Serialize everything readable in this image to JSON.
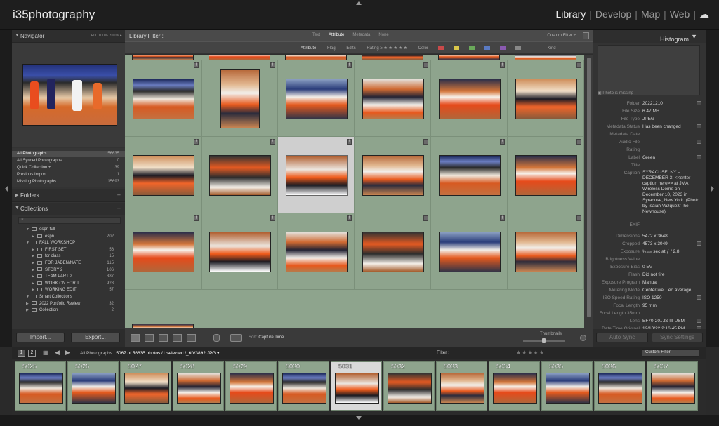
{
  "app": {
    "brand": "i35photography",
    "modules": [
      "Library",
      "Develop",
      "Map",
      "Web"
    ],
    "active_module": "Library",
    "cloud_icon": "cloud-icon"
  },
  "navigator": {
    "title": "Navigator",
    "zoom_levels": "FIT  100%  200%  ▸"
  },
  "catalog": [
    {
      "label": "All Photographs",
      "count": "56635",
      "selected": true
    },
    {
      "label": "All Synced Photographs",
      "count": "0"
    },
    {
      "label": "Quick Collection +",
      "count": "39"
    },
    {
      "label": "Previous Import",
      "count": "1"
    },
    {
      "label": "Missing Photographs",
      "count": "15693"
    }
  ],
  "folders": {
    "title": "Folders"
  },
  "collections": {
    "title": "Collections",
    "items": [
      {
        "label": "espn full",
        "count": "",
        "indent": 1
      },
      {
        "label": "espn",
        "count": "202",
        "indent": 2
      },
      {
        "label": "FALL WORKSHOP",
        "count": "",
        "indent": 1
      },
      {
        "label": "FIRST SET",
        "count": "56",
        "indent": 2
      },
      {
        "label": "for class",
        "count": "15",
        "indent": 2
      },
      {
        "label": "FOR JADEN/NATE",
        "count": "115",
        "indent": 2
      },
      {
        "label": "STORY 2",
        "count": "106",
        "indent": 2
      },
      {
        "label": "TEAM PART 2",
        "count": "387",
        "indent": 2
      },
      {
        "label": "WORK ON FOR T...",
        "count": "928",
        "indent": 2
      },
      {
        "label": "WORKING EDIT",
        "count": "57",
        "indent": 2
      },
      {
        "label": "Smart Collections",
        "count": "",
        "indent": 1
      },
      {
        "label": "2022 Portfolio Review",
        "count": "32",
        "indent": 1
      },
      {
        "label": "Collection",
        "count": "2",
        "indent": 1
      }
    ]
  },
  "left_buttons": {
    "import": "Import...",
    "export": "Export..."
  },
  "filter_bar": {
    "title": "Library Filter :",
    "tabs": [
      "Text",
      "Attribute",
      "Metadata",
      "None"
    ],
    "active_tab": "Attribute",
    "custom_filter": "Custom Filter ÷"
  },
  "attribute_bar": {
    "attribute": "Attribute",
    "flag": "Flag",
    "edits": "Edits",
    "rating": "Rating  ≥  ★ ★ ★ ★ ★",
    "color": "Color",
    "kind": "Kind",
    "swatches": [
      "#c94a4a",
      "#d9c64a",
      "#6aa85a",
      "#5a7ac2",
      "#8a5ab0",
      "#888888"
    ]
  },
  "grid": {
    "rows": [
      [
        "g3",
        "g1",
        "g5",
        "g6",
        "g2",
        "g4"
      ],
      [
        "g4",
        "g8",
        "g7",
        "g1",
        "g3",
        "g2"
      ],
      [
        "g2",
        "g7",
        "g6",
        "g8",
        "g5",
        "g1"
      ]
    ],
    "selected_index": 8
  },
  "toolbar": {
    "sort_label": "Sort:",
    "sort_value": "Capture Time",
    "thumbnails": "Thumbnails"
  },
  "histogram": {
    "title": "Histogram",
    "missing": "Photo is missing"
  },
  "metadata": [
    {
      "k": "Folder",
      "v": "20221210",
      "btn": true
    },
    {
      "k": "File Size",
      "v": "6.47 MB"
    },
    {
      "k": "File Type",
      "v": "JPEG"
    },
    {
      "k": "Metadata Status",
      "v": "Has been changed",
      "btn": true
    },
    {
      "k": "Metadata Date",
      "v": ""
    },
    {
      "k": "Audio File",
      "v": "",
      "btn": true
    },
    {
      "k": "Rating",
      "v": ""
    },
    {
      "k": "Label",
      "v": "Green",
      "btn": true
    },
    {
      "k": "Title",
      "v": ""
    },
    {
      "k": "Caption",
      "v": "SYRACUSE, NY – DECEMBER 3: <<enter caption here>> at JMA Wireless Dome on December 10, 2023 in Syracuse, New York. (Photo by Isaiah Vazquez/The Newhouse)",
      "tall": true
    },
    {
      "k": "EXIF",
      "v": ""
    },
    {
      "k": "Dimensions",
      "v": "5472 x 3648"
    },
    {
      "k": "Cropped",
      "v": "4573 x 3049",
      "btn": true
    },
    {
      "k": "Exposure",
      "v": "¹⁄₁₆₀₀ sec at ƒ / 2.8"
    },
    {
      "k": "Brightness Value",
      "v": ""
    },
    {
      "k": "Exposure Bias",
      "v": "0 EV"
    },
    {
      "k": "Flash",
      "v": "Did not fire"
    },
    {
      "k": "Exposure Program",
      "v": "Manual"
    },
    {
      "k": "Metering Mode",
      "v": "Center-wei...ed average"
    },
    {
      "k": "ISO Speed Rating",
      "v": "ISO 1250",
      "btn": true
    },
    {
      "k": "Focal Length",
      "v": "95 mm"
    },
    {
      "k": "Focal Length 35mm",
      "v": ""
    },
    {
      "k": "Lens",
      "v": "EF70-20...IS III USM",
      "btn": true
    },
    {
      "k": "Date Time Original",
      "v": "12/10/22 2:16:45 PM",
      "btn": true
    }
  ],
  "right_buttons": {
    "auto_sync": "Auto Sync",
    "sync_settings": "Sync Settings"
  },
  "filmstrip_bar": {
    "page1": "1",
    "page2": "2",
    "source": "All Photographs",
    "status": "5067 of 56635 photos /1 selected /_6IV3892.JPG ▾",
    "filter_label": "Filter :",
    "custom_filter": "Custom Filter"
  },
  "filmstrip": [
    {
      "num": "5025",
      "g": "g3"
    },
    {
      "num": "5026",
      "g": "g5"
    },
    {
      "num": "5027",
      "g": "g4"
    },
    {
      "num": "5028",
      "g": "g6"
    },
    {
      "num": "5029",
      "g": "g2"
    },
    {
      "num": "5030",
      "g": "g3"
    },
    {
      "num": "5031",
      "g": "g7",
      "selected": true
    },
    {
      "num": "5032",
      "g": "g8"
    },
    {
      "num": "5033",
      "g": "g1"
    },
    {
      "num": "5034",
      "g": "g2"
    },
    {
      "num": "5035",
      "g": "g5"
    },
    {
      "num": "5036",
      "g": "g3"
    },
    {
      "num": "5037",
      "g": "g6"
    }
  ]
}
